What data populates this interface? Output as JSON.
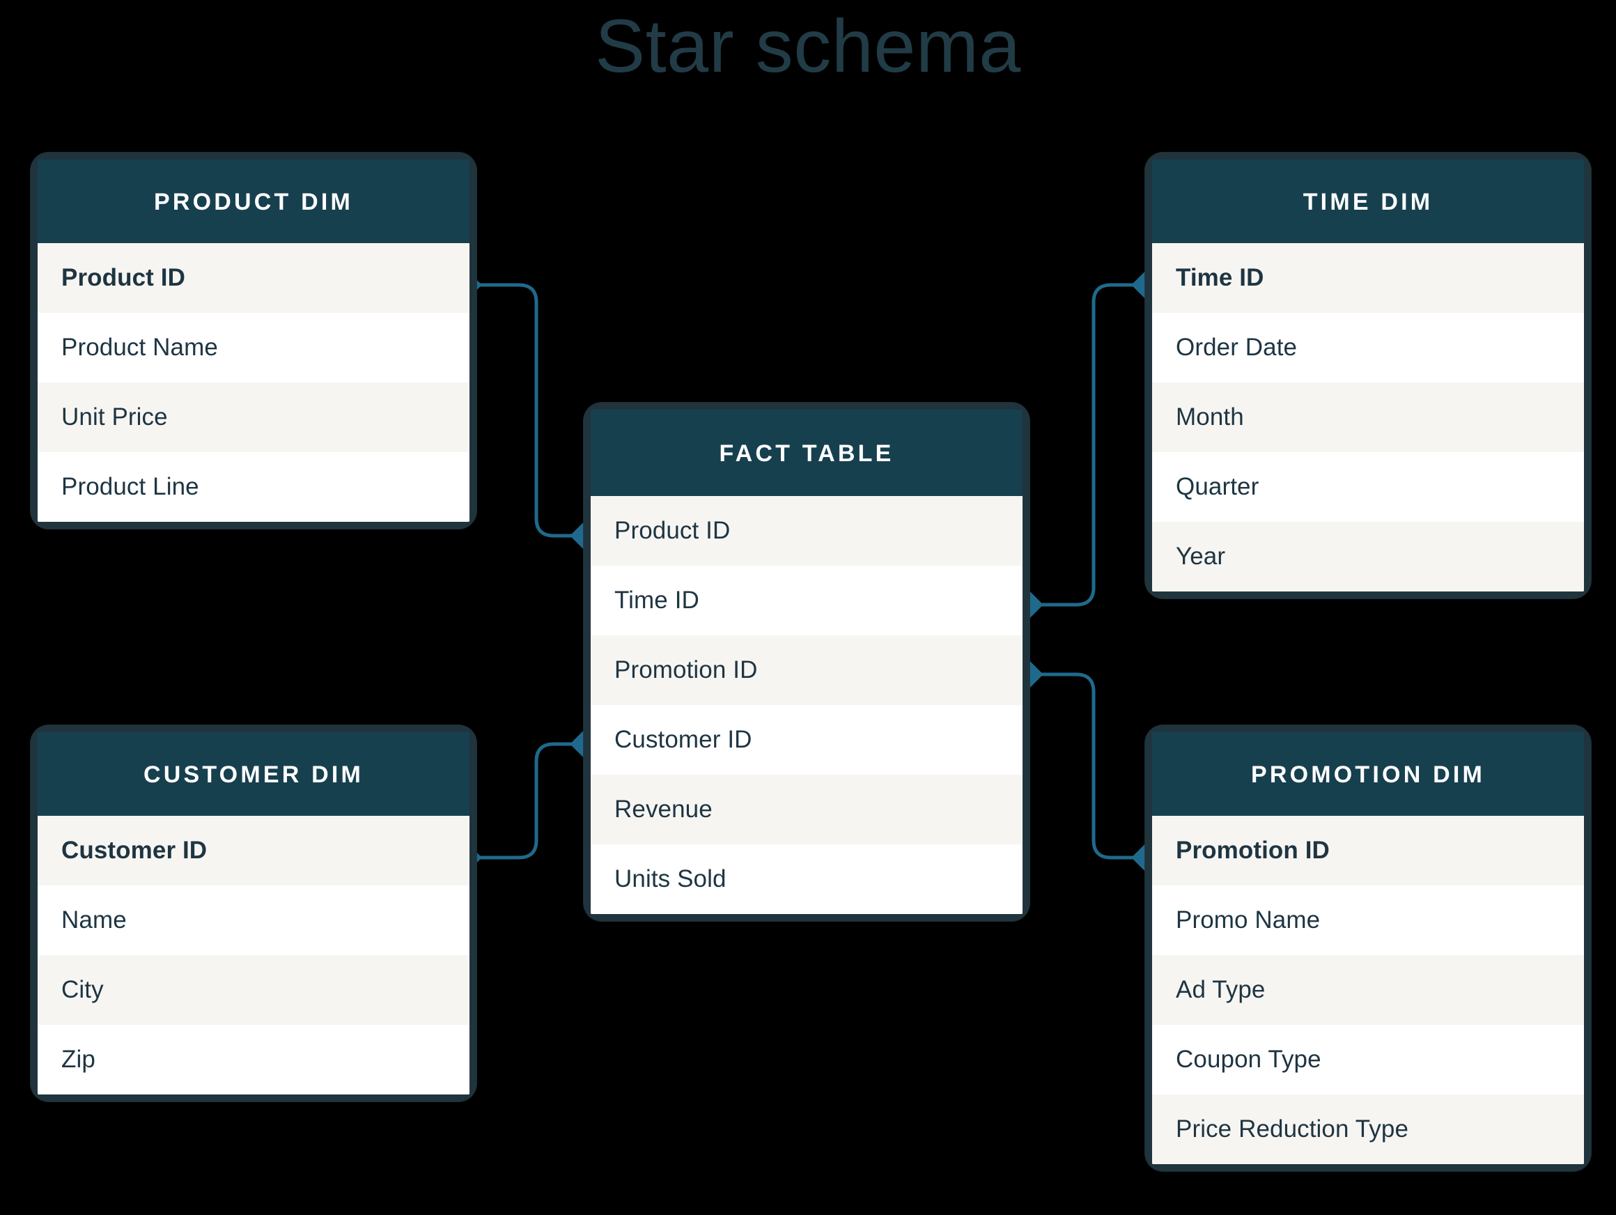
{
  "title": "Star schema",
  "colors": {
    "background": "#000000",
    "header_fill": "#17404f",
    "card_border": "#20343d",
    "row_white": "#ffffff",
    "row_alt": "#f7f5f2",
    "row_text": "#1e3542",
    "title_text": "#223c47",
    "connector": "#1f6a8c"
  },
  "tables": {
    "product_dim": {
      "title": "PRODUCT DIM",
      "rows": [
        {
          "label": "Product ID",
          "key": true
        },
        {
          "label": "Product Name",
          "key": false
        },
        {
          "label": "Unit Price",
          "key": false
        },
        {
          "label": "Product Line",
          "key": false
        }
      ]
    },
    "customer_dim": {
      "title": "CUSTOMER DIM",
      "rows": [
        {
          "label": "Customer ID",
          "key": true
        },
        {
          "label": "Name",
          "key": false
        },
        {
          "label": "City",
          "key": false
        },
        {
          "label": "Zip",
          "key": false
        }
      ]
    },
    "time_dim": {
      "title": "TIME DIM",
      "rows": [
        {
          "label": "Time ID",
          "key": true
        },
        {
          "label": "Order Date",
          "key": false
        },
        {
          "label": "Month",
          "key": false
        },
        {
          "label": "Quarter",
          "key": false
        },
        {
          "label": "Year",
          "key": false
        }
      ]
    },
    "promotion_dim": {
      "title": "PROMOTION DIM",
      "rows": [
        {
          "label": "Promotion ID",
          "key": true
        },
        {
          "label": "Promo Name",
          "key": false
        },
        {
          "label": "Ad Type",
          "key": false
        },
        {
          "label": "Coupon Type",
          "key": false
        },
        {
          "label": "Price Reduction Type",
          "key": false
        }
      ]
    },
    "fact_table": {
      "title": "FACT TABLE",
      "rows": [
        {
          "label": "Product ID",
          "key": false
        },
        {
          "label": "Time ID",
          "key": false
        },
        {
          "label": "Promotion ID",
          "key": false
        },
        {
          "label": "Customer ID",
          "key": false
        },
        {
          "label": "Revenue",
          "key": false
        },
        {
          "label": "Units Sold",
          "key": false
        }
      ]
    }
  },
  "relationships": [
    {
      "name": "product-to-fact",
      "from": "PRODUCT DIM.Product ID",
      "to": "FACT TABLE.Product ID"
    },
    {
      "name": "customer-to-fact",
      "from": "CUSTOMER DIM.Customer ID",
      "to": "FACT TABLE.Customer ID"
    },
    {
      "name": "fact-to-time",
      "from": "FACT TABLE.Time ID",
      "to": "TIME DIM.Time ID"
    },
    {
      "name": "fact-to-promotion",
      "from": "FACT TABLE.Promotion ID",
      "to": "PROMOTION DIM.Promotion ID"
    }
  ]
}
